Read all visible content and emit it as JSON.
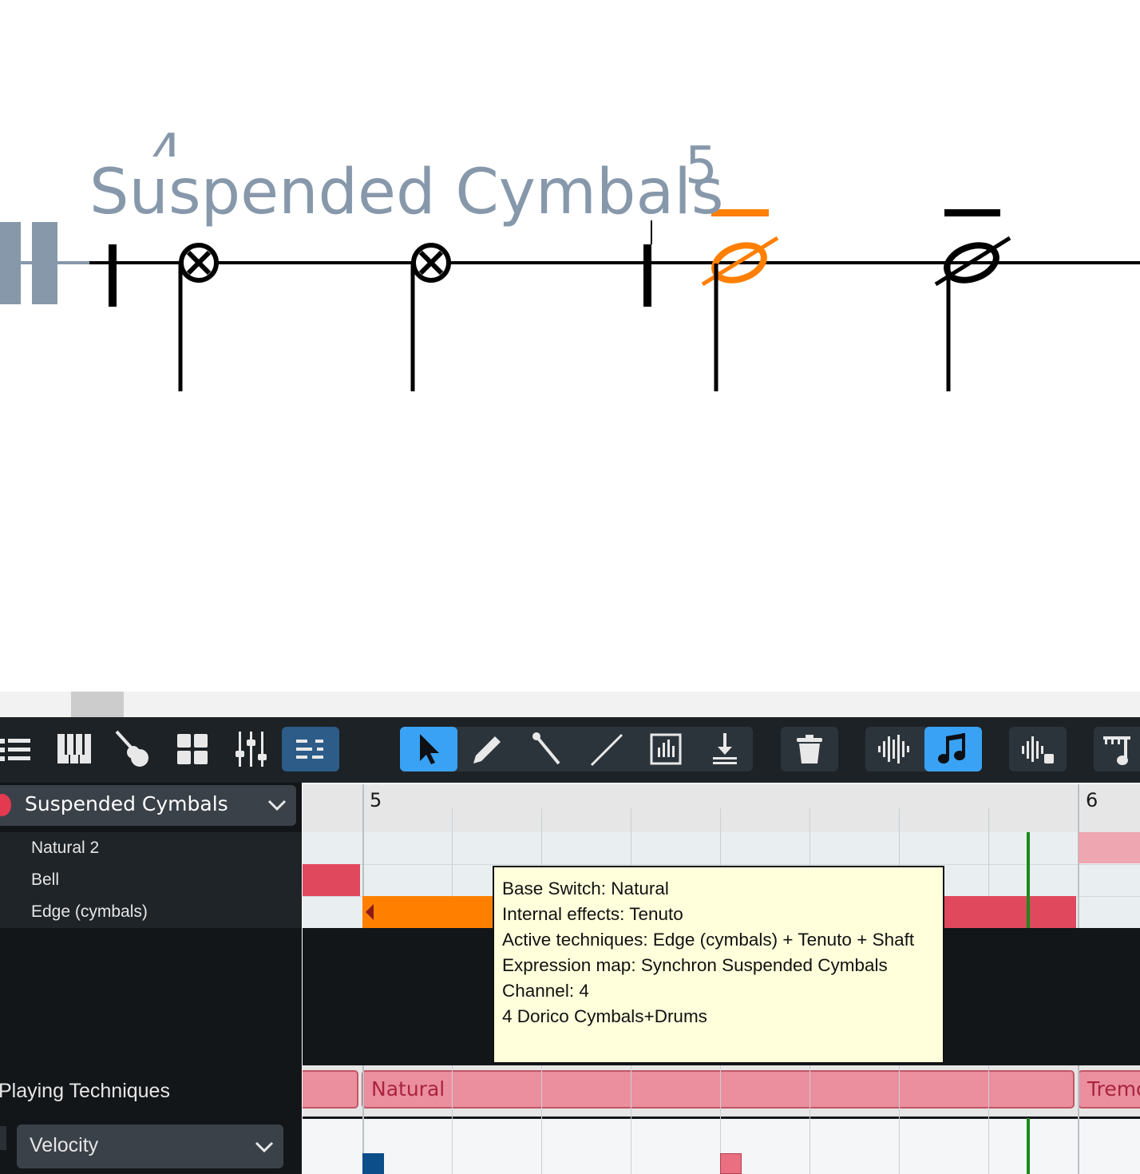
{
  "score": {
    "instrument_name": "Suspended Cymbals",
    "bar_number_prev": "4",
    "bar_number": "5",
    "colors": {
      "staff_label": "#8798ab",
      "selected_note": "#ff7f00",
      "ink": "#000000"
    }
  },
  "toolbar": {
    "left_icons": [
      "list-icon",
      "piano-keys-icon",
      "guitar-icon",
      "grid-icon",
      "mixer-icon",
      "key-editor-icon"
    ],
    "tool_icons": [
      "select-arrow-icon",
      "pencil-icon",
      "mallet-icon",
      "line-icon",
      "draw-box-icon",
      "download-icon"
    ],
    "other_icons": [
      "trash-icon",
      "waveform-icon",
      "music-note-icon",
      "waveform-lock-icon",
      "ruler-note-icon"
    ],
    "colors": {
      "active": "#3aa2f4",
      "selected": "#2c5c87",
      "button": "#2c343b",
      "bar": "#1d2226"
    }
  },
  "track": {
    "name": "Suspended Cymbals",
    "lanes": [
      "Natural 2",
      "Bell",
      "Edge (cymbals)"
    ],
    "color": "#e33a52"
  },
  "ruler": {
    "bar_a": "5",
    "bar_b": "6"
  },
  "tooltip": {
    "lines": [
      "Base Switch: Natural",
      "Internal effects: Tenuto",
      "Active techniques: Edge (cymbals) + Tenuto + Shaft",
      "Expression map: Synchron Suspended Cymbals",
      "Channel: 4",
      "4 Dorico Cymbals+Drums"
    ]
  },
  "playing_techniques": {
    "label": "Playing Techniques",
    "blocks": [
      "Natural",
      "Tremolo"
    ]
  },
  "velocity": {
    "label": "Velocity"
  },
  "colors": {
    "note_red": "#e0485e",
    "note_orange": "#ff8000",
    "playhead": "#1a8a1a",
    "pt_fill": "#eb8f9e",
    "pt_text": "#a9243e"
  }
}
